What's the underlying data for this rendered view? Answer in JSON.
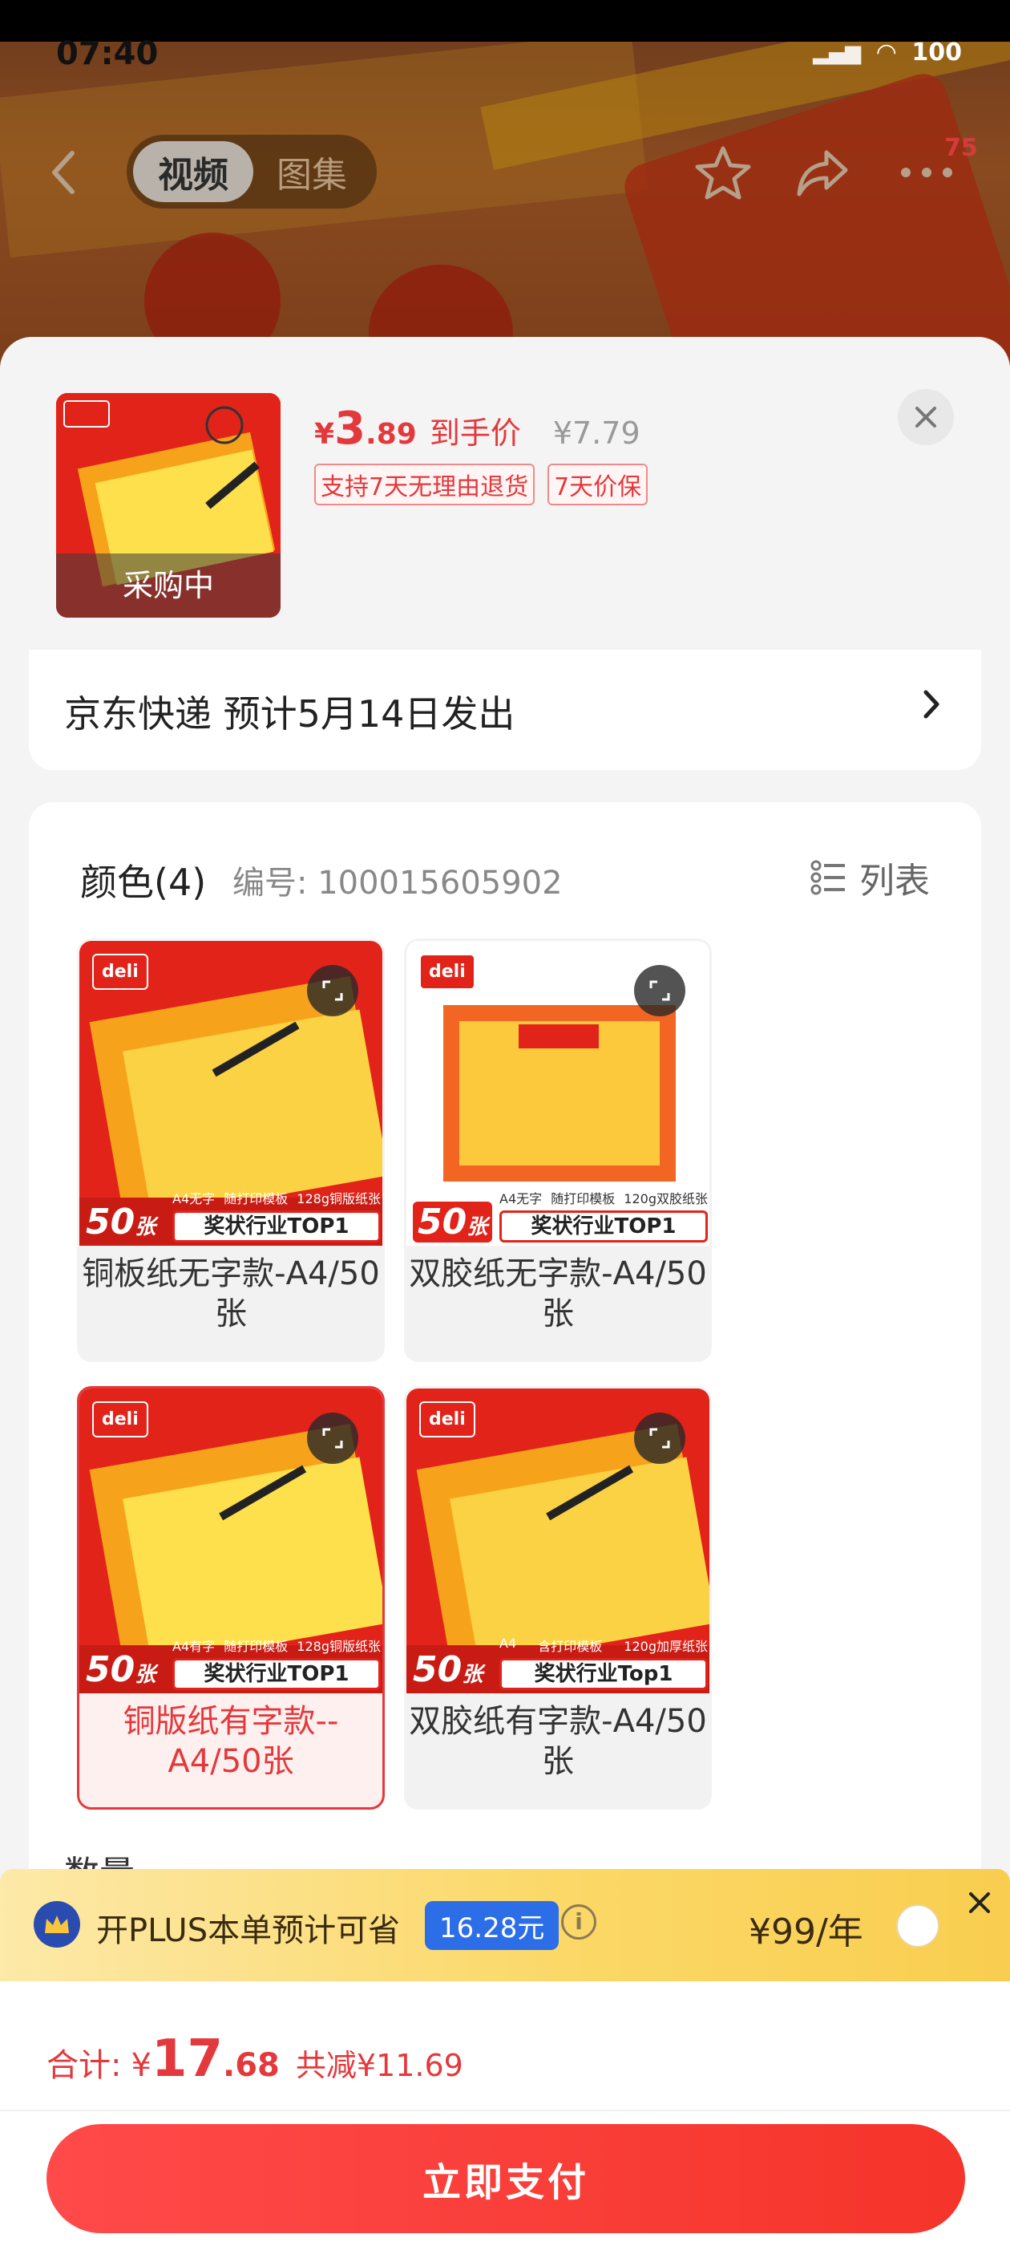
{
  "status_bar": {
    "time": "07:40",
    "battery": "100"
  },
  "header": {
    "tabs": [
      {
        "label": "视频",
        "active": true
      },
      {
        "label": "图集",
        "active": false
      }
    ],
    "badge": "75"
  },
  "product": {
    "thumb_tag": "采购中",
    "price_currency": "¥",
    "price_int": "3",
    "price_dec": ".89",
    "price_label": "到手价",
    "original_price": "¥7.79",
    "tags": [
      "支持7天无理由退货",
      "7天价保"
    ]
  },
  "shipping": {
    "text": "京东快递 预计5月14日发出"
  },
  "spec": {
    "title": "颜色(4)",
    "item_id": "编号: 100015605902",
    "view_toggle": "列表",
    "options": [
      {
        "label": "铜板纸无字款-A4/50张",
        "selected": false,
        "count": "50",
        "unit": "张",
        "ribbon": "奖状行业TOP1",
        "info": [
          "A4无字",
          "随打印模板",
          "128g铜版纸张"
        ]
      },
      {
        "label": "双胶纸无字款-A4/50张",
        "selected": false,
        "count": "50",
        "unit": "张",
        "ribbon": "奖状行业TOP1",
        "info": [
          "A4无字",
          "随打印模板",
          "120g双胶纸张"
        ]
      },
      {
        "label": "铜版纸有字款--A4/50张",
        "selected": true,
        "count": "50",
        "unit": "张",
        "ribbon": "奖状行业TOP1",
        "info": [
          "A4有字",
          "随打印模板",
          "128g铜版纸张"
        ]
      },
      {
        "label": "双胶纸有字款-A4/50张",
        "selected": false,
        "count": "50",
        "unit": "张",
        "ribbon": "奖状行业Top1",
        "info": [
          "A4",
          "含打印模板",
          "120g加厚纸张"
        ]
      }
    ],
    "brand": "deli"
  },
  "qty_label": "数量",
  "plus": {
    "text": "开PLUS本单预计可省",
    "save": "16.28元",
    "info_icon": "i",
    "price": "¥99/年"
  },
  "footer": {
    "total_label": "合计:",
    "currency": "¥",
    "total_int": "17",
    "total_dec": ".68",
    "reduced": "共减¥11.69",
    "pay_button": "立即支付"
  },
  "colors": {
    "accent": "#e4393c",
    "pay": "#f5342a",
    "plus_blue": "#2c6de8"
  },
  "icons": [
    "back-icon",
    "star-icon",
    "share-icon",
    "more-icon",
    "close-icon",
    "chevron-right-icon",
    "list-icon",
    "expand-icon",
    "crown-icon",
    "info-icon"
  ]
}
